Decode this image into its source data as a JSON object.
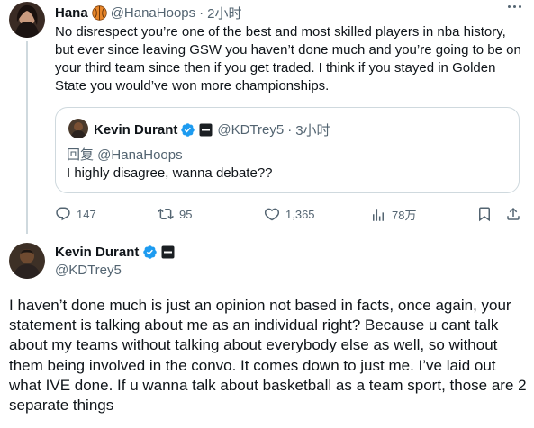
{
  "tweet": {
    "name": "Hana",
    "handle": "@HanaHoops",
    "separator": "·",
    "time": "2小时",
    "text": "No disrespect you’re one of the best and most skilled players in nba history, but ever since leaving GSW you haven’t done much and you’re going to be on your third team since then if you get traded. I think if you stayed in Golden State you would’ve won more championships.",
    "badge_icon": "basketball-icon",
    "quote": {
      "name": "Kevin Durant",
      "handle": "@KDTrey5",
      "separator": "·",
      "time": "3小时",
      "reply_to": "回复 @HanaHoops",
      "text": "I highly disagree, wanna debate??"
    },
    "actions": {
      "replies": "147",
      "retweets": "95",
      "likes": "1,365",
      "views": "78万"
    }
  },
  "reply": {
    "name": "Kevin Durant",
    "handle": "@KDTrey5",
    "text": "I haven’t done much is just an opinion not based in facts, once again, your statement is talking about me as an individual right? Because u cant talk about my teams without talking about everybody else as well, so without them being involved in the convo. It comes down to just me. I’ve laid out what IVE done. If u wanna talk about basketball as a team sport, those are 2 separate things"
  },
  "colors": {
    "text": "#0f1419",
    "muted": "#536471",
    "border": "#cfd9de",
    "verified": "#1d9bf0",
    "basketball": "#e8862a"
  }
}
